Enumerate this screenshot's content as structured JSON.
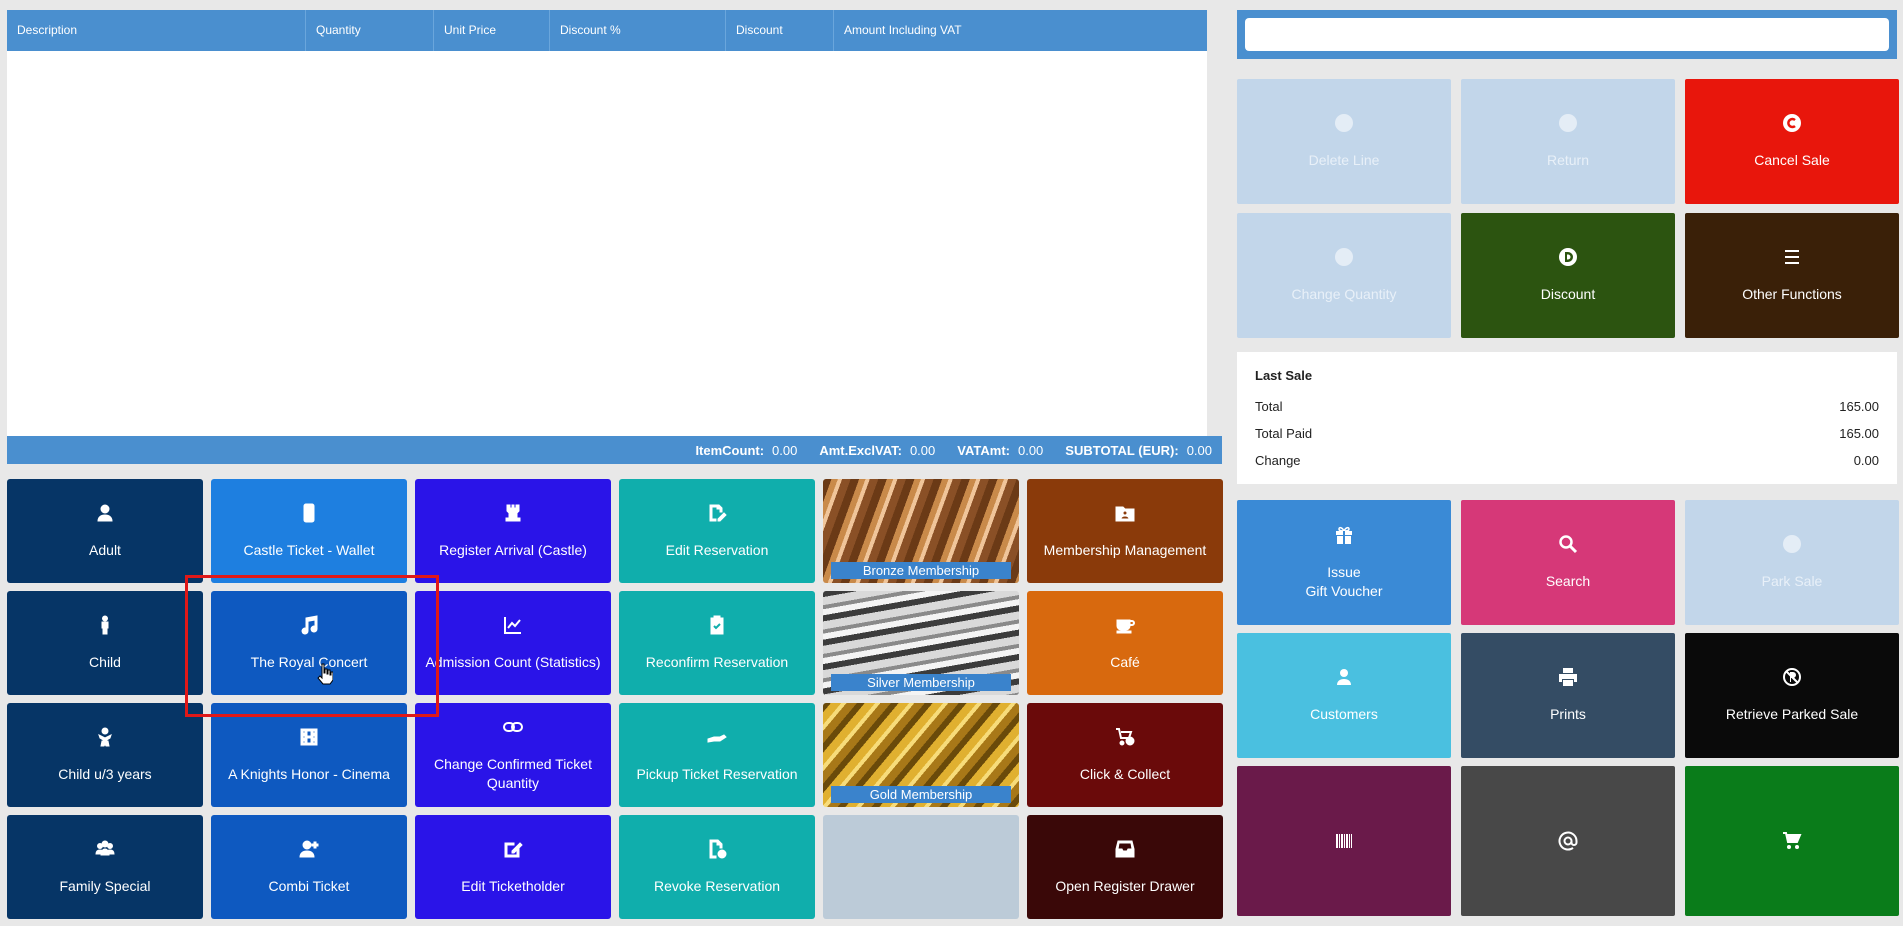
{
  "grid": {
    "columns": [
      "Description",
      "Quantity",
      "Unit Price",
      "Discount %",
      "Discount",
      "Amount Including VAT"
    ],
    "totals": {
      "item_count_label": "ItemCount:",
      "item_count": "0.00",
      "amt_excl_vat_label": "Amt.ExclVAT:",
      "amt_excl_vat": "0.00",
      "vat_amt_label": "VATAmt:",
      "vat_amt": "0.00",
      "subtotal_label": "SUBTOTAL (EUR):",
      "subtotal": "0.00"
    }
  },
  "tiles": [
    {
      "label": "Adult",
      "icon": "user-icon"
    },
    {
      "label": "Castle Ticket - Wallet",
      "icon": "phone-icon"
    },
    {
      "label": "Register Arrival (Castle)",
      "icon": "chess-rook-icon"
    },
    {
      "label": "Edit Reservation",
      "icon": "file-edit-icon"
    },
    {
      "label": "Bronze Membership",
      "icon": ""
    },
    {
      "label": "Membership Management",
      "icon": "folder-user-icon"
    },
    {
      "label": "Child",
      "icon": "child-icon"
    },
    {
      "label": "The Royal Concert",
      "icon": "music-icon"
    },
    {
      "label": "Admission Count (Statistics)",
      "icon": "chart-line-icon"
    },
    {
      "label": "Reconfirm Reservation",
      "icon": "clipboard-check-icon"
    },
    {
      "label": "Silver Membership",
      "icon": ""
    },
    {
      "label": "Café",
      "icon": "coffee-icon"
    },
    {
      "label": "Child u/3 years",
      "icon": "baby-icon"
    },
    {
      "label": "A Knights Honor - Cinema",
      "icon": "film-icon"
    },
    {
      "label": "Change Confirmed Ticket Quantity",
      "icon": "link-icon"
    },
    {
      "label": "Pickup Ticket Reservation",
      "icon": "hand-icon"
    },
    {
      "label": "Gold Membership",
      "icon": ""
    },
    {
      "label": "Click & Collect",
      "icon": "cart-clock-icon"
    },
    {
      "label": "Family Special",
      "icon": "users-icon"
    },
    {
      "label": "Combi Ticket",
      "icon": "user-plus-icon"
    },
    {
      "label": "Edit Ticketholder",
      "icon": "edit-icon"
    },
    {
      "label": "Revoke Reservation",
      "icon": "file-clock-icon"
    },
    {
      "label": "",
      "icon": ""
    },
    {
      "label": "Open Register Drawer",
      "icon": "drawer-icon"
    }
  ],
  "search": {
    "value": "",
    "placeholder": ""
  },
  "functions_top": [
    {
      "label": "Delete Line",
      "icon": "circle-minus-icon"
    },
    {
      "label": "Return",
      "icon": "circle-return-icon"
    },
    {
      "label": "Cancel Sale",
      "icon": "circle-cancel-icon"
    },
    {
      "label": "Change Quantity",
      "icon": "circle-quantity-icon"
    },
    {
      "label": "Discount",
      "icon": "circle-discount-icon"
    },
    {
      "label": "Other Functions",
      "icon": "bars-icon"
    }
  ],
  "last_sale": {
    "title": "Last Sale",
    "total_label": "Total",
    "total": "165.00",
    "total_paid_label": "Total Paid",
    "total_paid": "165.00",
    "change_label": "Change",
    "change": "0.00"
  },
  "functions_bottom": [
    {
      "label_line1": "Issue",
      "label_line2": "Gift Voucher",
      "icon": "gift-icon"
    },
    {
      "label_line1": "Search",
      "label_line2": "",
      "icon": "search-icon"
    },
    {
      "label_line1": "Park Sale",
      "label_line2": "",
      "icon": "park-icon"
    },
    {
      "label_line1": "Customers",
      "label_line2": "",
      "icon": "user-icon"
    },
    {
      "label_line1": "Prints",
      "label_line2": "",
      "icon": "printer-icon"
    },
    {
      "label_line1": "Retrieve Parked Sale",
      "label_line2": "",
      "icon": "no-parking-icon"
    },
    {
      "label_line1": "",
      "label_line2": "",
      "icon": "barcode-icon"
    },
    {
      "label_line1": "",
      "label_line2": "",
      "icon": "at-icon"
    },
    {
      "label_line1": "",
      "label_line2": "",
      "icon": "cart-icon"
    }
  ]
}
